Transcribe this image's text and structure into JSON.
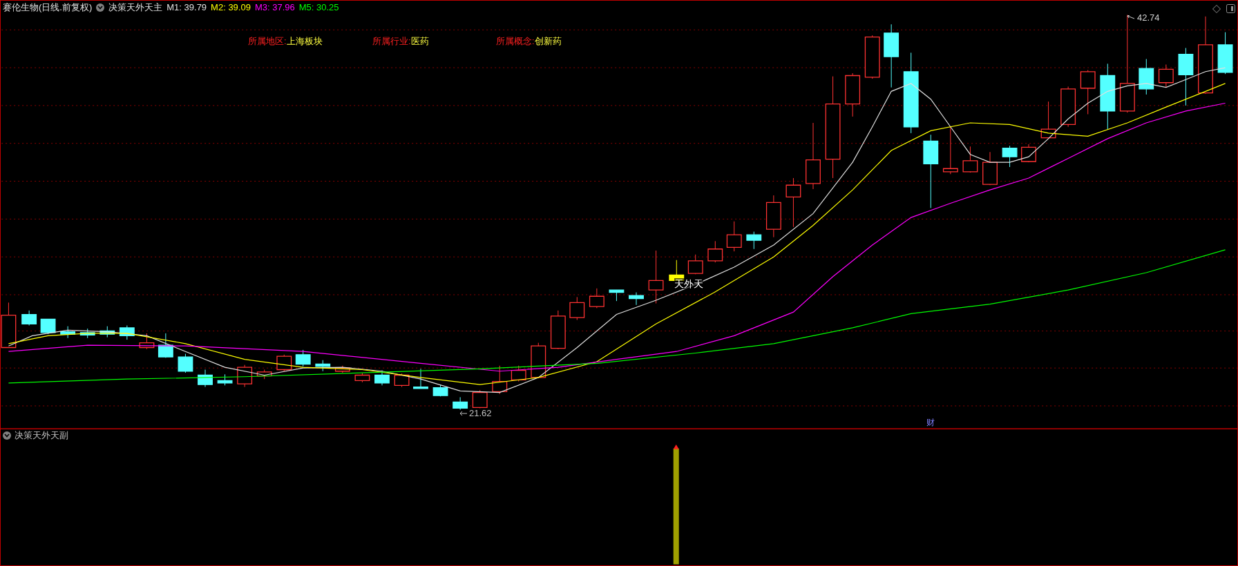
{
  "header": {
    "stock": "赛伦生物(日线.前复权)",
    "indicator": "决策天外天主",
    "ma": [
      {
        "label": "M1:",
        "value": "39.79",
        "color": "#e0e0e0"
      },
      {
        "label": "M2:",
        "value": "39.09",
        "color": "#ffff00"
      },
      {
        "label": "M3:",
        "value": "37.96",
        "color": "#ff00ff"
      },
      {
        "label": "M5:",
        "value": "30.25",
        "color": "#00ff00"
      }
    ]
  },
  "info": [
    {
      "label": "所属地区:",
      "value": "上海板块"
    },
    {
      "label": "所属行业:",
      "value": "医药"
    },
    {
      "label": "所属概念:",
      "value": "创新药"
    }
  ],
  "annotations": {
    "high": "42.74",
    "low": "21.62",
    "signal": "天外天",
    "marker": "财"
  },
  "sub_panel": {
    "title": "决策天外天副"
  }
}
